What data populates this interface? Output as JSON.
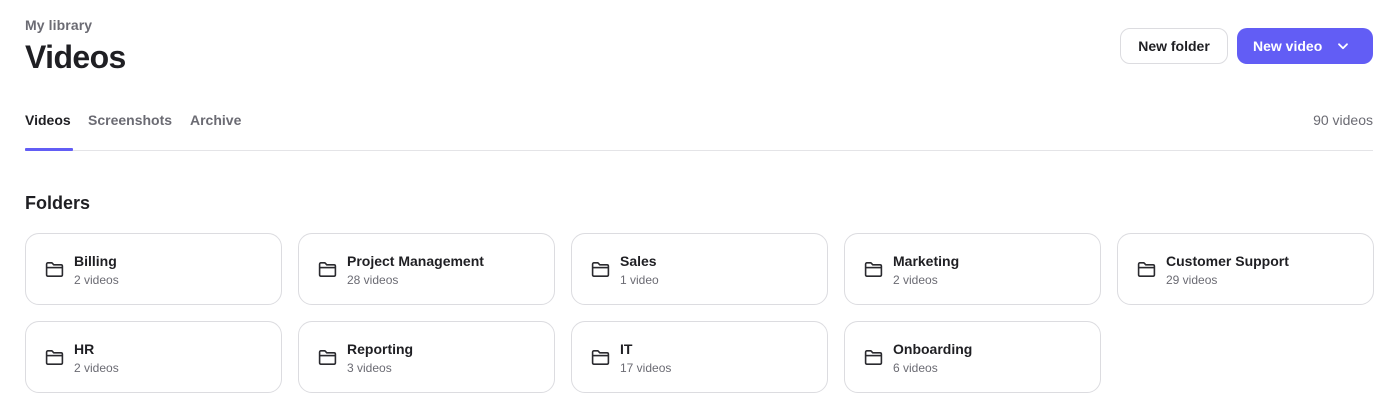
{
  "header": {
    "breadcrumb": "My library",
    "title": "Videos"
  },
  "actions": {
    "new_folder_label": "New folder",
    "new_video_label": "New video"
  },
  "tabs": [
    {
      "label": "Videos",
      "active": true
    },
    {
      "label": "Screenshots",
      "active": false
    },
    {
      "label": "Archive",
      "active": false
    }
  ],
  "video_count": "90 videos",
  "folders_section": {
    "title": "Folders",
    "items": [
      {
        "name": "Billing",
        "count": "2 videos"
      },
      {
        "name": "Project Management",
        "count": "28 videos"
      },
      {
        "name": "Sales",
        "count": "1 video"
      },
      {
        "name": "Marketing",
        "count": "2 videos"
      },
      {
        "name": "Customer Support",
        "count": "29 videos"
      },
      {
        "name": "HR",
        "count": "2 videos"
      },
      {
        "name": "Reporting",
        "count": "3 videos"
      },
      {
        "name": "IT",
        "count": "17 videos"
      },
      {
        "name": "Onboarding",
        "count": "6 videos"
      }
    ]
  },
  "colors": {
    "accent": "#625df5",
    "text": "#1f1f23",
    "muted": "#6b6b73",
    "border": "#dcdce0"
  },
  "icons": {
    "folder": "folder-icon",
    "dropdown": "chevron-down-icon"
  }
}
